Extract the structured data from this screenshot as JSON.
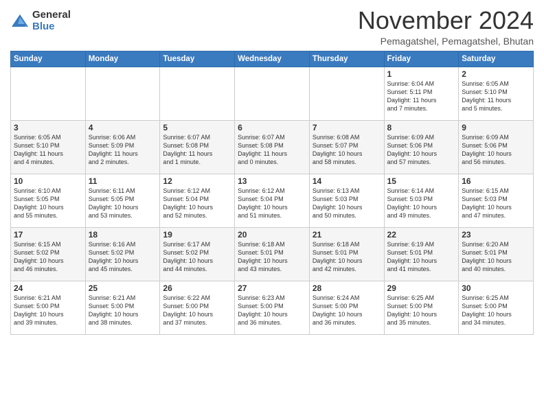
{
  "header": {
    "logo_general": "General",
    "logo_blue": "Blue",
    "month": "November 2024",
    "location": "Pemagatshel, Pemagatshel, Bhutan"
  },
  "weekdays": [
    "Sunday",
    "Monday",
    "Tuesday",
    "Wednesday",
    "Thursday",
    "Friday",
    "Saturday"
  ],
  "weeks": [
    [
      {
        "day": "",
        "info": ""
      },
      {
        "day": "",
        "info": ""
      },
      {
        "day": "",
        "info": ""
      },
      {
        "day": "",
        "info": ""
      },
      {
        "day": "",
        "info": ""
      },
      {
        "day": "1",
        "info": "Sunrise: 6:04 AM\nSunset: 5:11 PM\nDaylight: 11 hours\nand 7 minutes."
      },
      {
        "day": "2",
        "info": "Sunrise: 6:05 AM\nSunset: 5:10 PM\nDaylight: 11 hours\nand 5 minutes."
      }
    ],
    [
      {
        "day": "3",
        "info": "Sunrise: 6:05 AM\nSunset: 5:10 PM\nDaylight: 11 hours\nand 4 minutes."
      },
      {
        "day": "4",
        "info": "Sunrise: 6:06 AM\nSunset: 5:09 PM\nDaylight: 11 hours\nand 2 minutes."
      },
      {
        "day": "5",
        "info": "Sunrise: 6:07 AM\nSunset: 5:08 PM\nDaylight: 11 hours\nand 1 minute."
      },
      {
        "day": "6",
        "info": "Sunrise: 6:07 AM\nSunset: 5:08 PM\nDaylight: 11 hours\nand 0 minutes."
      },
      {
        "day": "7",
        "info": "Sunrise: 6:08 AM\nSunset: 5:07 PM\nDaylight: 10 hours\nand 58 minutes."
      },
      {
        "day": "8",
        "info": "Sunrise: 6:09 AM\nSunset: 5:06 PM\nDaylight: 10 hours\nand 57 minutes."
      },
      {
        "day": "9",
        "info": "Sunrise: 6:09 AM\nSunset: 5:06 PM\nDaylight: 10 hours\nand 56 minutes."
      }
    ],
    [
      {
        "day": "10",
        "info": "Sunrise: 6:10 AM\nSunset: 5:05 PM\nDaylight: 10 hours\nand 55 minutes."
      },
      {
        "day": "11",
        "info": "Sunrise: 6:11 AM\nSunset: 5:05 PM\nDaylight: 10 hours\nand 53 minutes."
      },
      {
        "day": "12",
        "info": "Sunrise: 6:12 AM\nSunset: 5:04 PM\nDaylight: 10 hours\nand 52 minutes."
      },
      {
        "day": "13",
        "info": "Sunrise: 6:12 AM\nSunset: 5:04 PM\nDaylight: 10 hours\nand 51 minutes."
      },
      {
        "day": "14",
        "info": "Sunrise: 6:13 AM\nSunset: 5:03 PM\nDaylight: 10 hours\nand 50 minutes."
      },
      {
        "day": "15",
        "info": "Sunrise: 6:14 AM\nSunset: 5:03 PM\nDaylight: 10 hours\nand 49 minutes."
      },
      {
        "day": "16",
        "info": "Sunrise: 6:15 AM\nSunset: 5:03 PM\nDaylight: 10 hours\nand 47 minutes."
      }
    ],
    [
      {
        "day": "17",
        "info": "Sunrise: 6:15 AM\nSunset: 5:02 PM\nDaylight: 10 hours\nand 46 minutes."
      },
      {
        "day": "18",
        "info": "Sunrise: 6:16 AM\nSunset: 5:02 PM\nDaylight: 10 hours\nand 45 minutes."
      },
      {
        "day": "19",
        "info": "Sunrise: 6:17 AM\nSunset: 5:02 PM\nDaylight: 10 hours\nand 44 minutes."
      },
      {
        "day": "20",
        "info": "Sunrise: 6:18 AM\nSunset: 5:01 PM\nDaylight: 10 hours\nand 43 minutes."
      },
      {
        "day": "21",
        "info": "Sunrise: 6:18 AM\nSunset: 5:01 PM\nDaylight: 10 hours\nand 42 minutes."
      },
      {
        "day": "22",
        "info": "Sunrise: 6:19 AM\nSunset: 5:01 PM\nDaylight: 10 hours\nand 41 minutes."
      },
      {
        "day": "23",
        "info": "Sunrise: 6:20 AM\nSunset: 5:01 PM\nDaylight: 10 hours\nand 40 minutes."
      }
    ],
    [
      {
        "day": "24",
        "info": "Sunrise: 6:21 AM\nSunset: 5:00 PM\nDaylight: 10 hours\nand 39 minutes."
      },
      {
        "day": "25",
        "info": "Sunrise: 6:21 AM\nSunset: 5:00 PM\nDaylight: 10 hours\nand 38 minutes."
      },
      {
        "day": "26",
        "info": "Sunrise: 6:22 AM\nSunset: 5:00 PM\nDaylight: 10 hours\nand 37 minutes."
      },
      {
        "day": "27",
        "info": "Sunrise: 6:23 AM\nSunset: 5:00 PM\nDaylight: 10 hours\nand 36 minutes."
      },
      {
        "day": "28",
        "info": "Sunrise: 6:24 AM\nSunset: 5:00 PM\nDaylight: 10 hours\nand 36 minutes."
      },
      {
        "day": "29",
        "info": "Sunrise: 6:25 AM\nSunset: 5:00 PM\nDaylight: 10 hours\nand 35 minutes."
      },
      {
        "day": "30",
        "info": "Sunrise: 6:25 AM\nSunset: 5:00 PM\nDaylight: 10 hours\nand 34 minutes."
      }
    ]
  ]
}
